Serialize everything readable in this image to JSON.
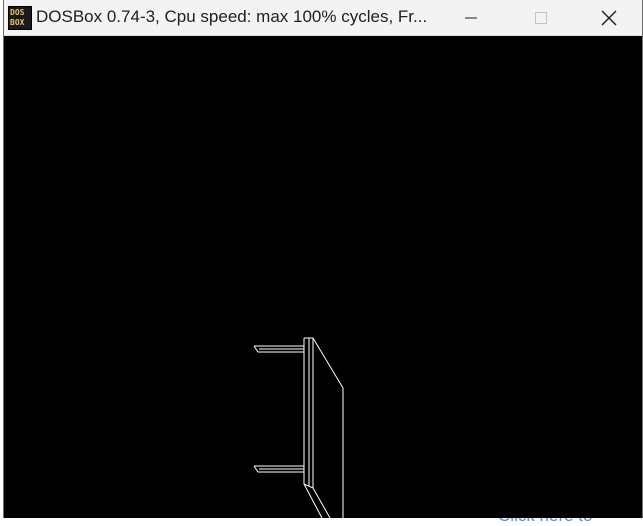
{
  "window": {
    "title": "DOSBox 0.74-3, Cpu speed: max 100% cycles, Fr...",
    "icon": {
      "name": "dosbox-icon",
      "line1": "DOS",
      "line2": "BOX"
    },
    "controls": {
      "minimize": "minimize-icon",
      "maximize": "maximize-icon",
      "close": "close-icon"
    }
  },
  "desktop": {
    "link_text": "Click here to"
  },
  "colors": {
    "titlebar_bg": "#f3f3f3",
    "client_bg": "#000000",
    "wire": "#ffffff",
    "link": "#4a90d9"
  }
}
